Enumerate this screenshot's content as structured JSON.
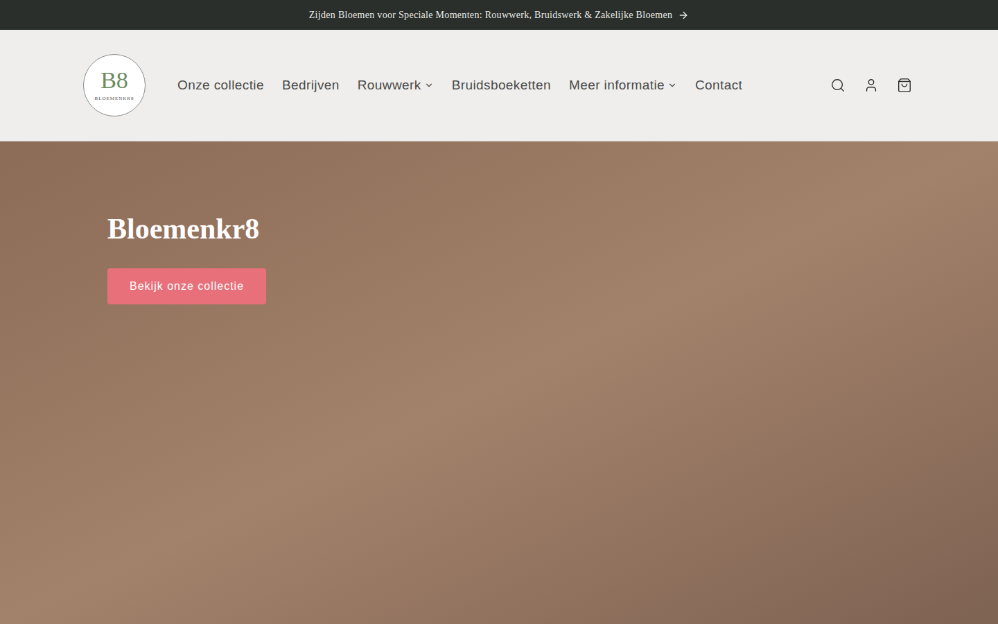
{
  "announcement": {
    "text": "Zijden Bloemen voor Speciale Momenten: Rouwwerk, Bruidswerk & Zakelijke Bloemen"
  },
  "logo": {
    "monogram": "B8",
    "name": "BLOEMENKR8"
  },
  "nav": [
    {
      "label": "Onze collectie",
      "dropdown": false
    },
    {
      "label": "Bedrijven",
      "dropdown": false
    },
    {
      "label": "Rouwwerk",
      "dropdown": true
    },
    {
      "label": "Bruidsboeketten",
      "dropdown": false
    },
    {
      "label": "Meer informatie",
      "dropdown": true
    },
    {
      "label": "Contact",
      "dropdown": false
    }
  ],
  "hero": {
    "title": "Bloemenkr8",
    "button": "Bekijk onze collectie"
  }
}
